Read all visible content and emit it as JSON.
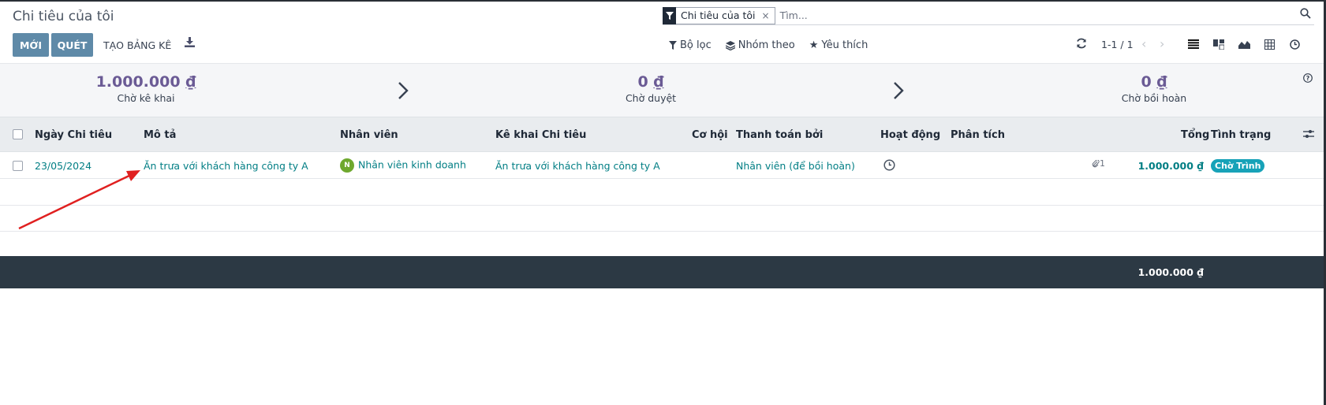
{
  "header": {
    "title": "Chi tiêu của tôi"
  },
  "search": {
    "facet": "Chi tiêu của tôi",
    "placeholder": "Tìm..."
  },
  "toolbar": {
    "new_label": "MỚI",
    "scan_label": "QUÉT",
    "report_label": "TẠO BẢNG KÊ"
  },
  "filters": {
    "filter_label": "Bộ lọc",
    "group_label": "Nhóm theo",
    "fav_label": "Yêu thích"
  },
  "pager": {
    "value": "1-1 / 1"
  },
  "stages": [
    {
      "amount": "1.000.000",
      "currency": "₫",
      "label": "Chờ kê khai"
    },
    {
      "amount": "0",
      "currency": "₫",
      "label": "Chờ duyệt"
    },
    {
      "amount": "0",
      "currency": "₫",
      "label": "Chờ bồi hoàn"
    }
  ],
  "table": {
    "columns": [
      "Ngày Chi tiêu",
      "Mô tả",
      "Nhân viên",
      "Kê khai Chi tiêu",
      "Cơ hội",
      "Thanh toán bởi",
      "Hoạt động",
      "Phân tích",
      "Tổng",
      "Tình trạng"
    ],
    "rows": [
      {
        "date": "23/05/2024",
        "description": "Ăn trưa với khách hàng công ty A",
        "employee_initial": "N",
        "employee": "Nhân viên kinh doanh",
        "report": "Ăn trưa với khách hàng công ty A",
        "paid_by": "Nhân viên (để bồi hoàn)",
        "attachments": "1",
        "total": "1.000.000 ₫",
        "status": "Chờ Trình"
      }
    ]
  },
  "footer": {
    "total": "1.000.000 ₫"
  },
  "colors": {
    "primary": "#5f8aa8",
    "link": "#017e84",
    "stage_amount": "#6b5b95",
    "footer_bg": "#2c3944",
    "badge": "#17a2b8",
    "annotation_arrow": "#e02020"
  }
}
